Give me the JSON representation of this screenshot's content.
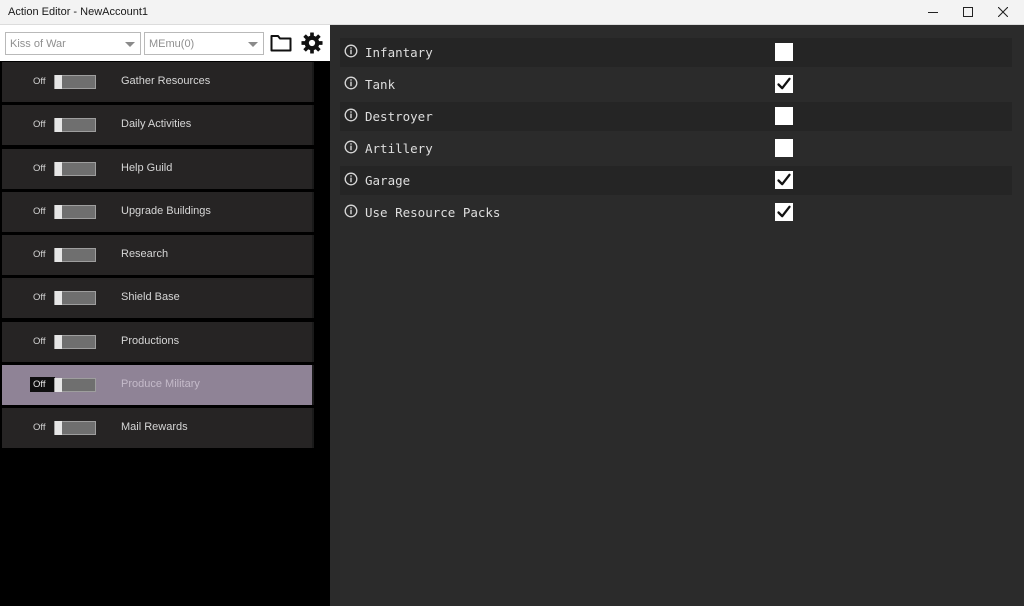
{
  "window": {
    "title": "Action Editor - NewAccount1"
  },
  "toolbar": {
    "game_select": "Kiss of War",
    "emulator_select": "MEmu(0)",
    "folder_icon": "folder-icon",
    "settings_icon": "gear-icon"
  },
  "actions": [
    {
      "state": "Off",
      "label": "Gather Resources",
      "selected": false
    },
    {
      "state": "Off",
      "label": "Daily Activities",
      "selected": false
    },
    {
      "state": "Off",
      "label": "Help Guild",
      "selected": false
    },
    {
      "state": "Off",
      "label": "Upgrade Buildings",
      "selected": false
    },
    {
      "state": "Off",
      "label": "Research",
      "selected": false
    },
    {
      "state": "Off",
      "label": "Shield Base",
      "selected": false
    },
    {
      "state": "Off",
      "label": "Productions",
      "selected": false
    },
    {
      "state": "Off",
      "label": "Produce Military",
      "selected": true
    },
    {
      "state": "Off",
      "label": "Mail Rewards",
      "selected": false
    }
  ],
  "options": [
    {
      "label": "Infantary",
      "checked": false
    },
    {
      "label": "Tank",
      "checked": true
    },
    {
      "label": "Destroyer",
      "checked": false
    },
    {
      "label": "Artillery",
      "checked": false
    },
    {
      "label": "Garage",
      "checked": true
    },
    {
      "label": "Use Resource Packs",
      "checked": true
    }
  ],
  "colors": {
    "selected_action": "#8f8396",
    "action_bg": "#262424",
    "panel_bg": "#2b2b2b"
  }
}
